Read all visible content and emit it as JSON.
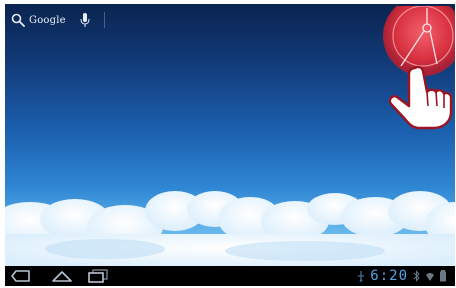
{
  "search": {
    "label": "Google"
  },
  "status": {
    "time": "6:20"
  },
  "icons": {
    "search": "search-icon",
    "mic": "mic-icon",
    "back": "back-icon",
    "home": "home-icon",
    "recents": "recent-apps-icon",
    "usb": "usb-icon",
    "bluetooth": "bluetooth-icon",
    "wifi": "wifi-icon",
    "battery": "battery-icon",
    "touch": "touch-indicator-icon",
    "hand": "hand-pointer-icon"
  },
  "colors": {
    "clock": "#4fa6e6",
    "touch_highlight": "#d8303f",
    "navbar": "#000000"
  }
}
